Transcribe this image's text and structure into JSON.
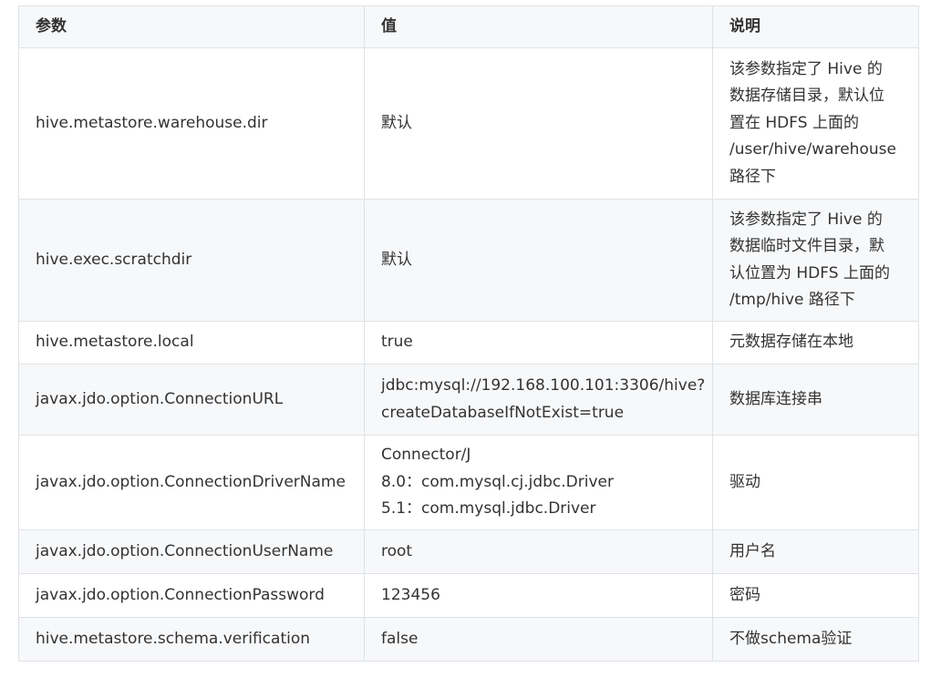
{
  "table": {
    "headers": [
      "参数",
      "值",
      "说明"
    ],
    "rows": [
      {
        "param": "hive.metastore.warehouse.dir",
        "value": [
          "默认"
        ],
        "desc": [
          "该参数指定了 Hive 的",
          "数据存储目录，默认位",
          "置在 HDFS 上面的",
          "/user/hive/warehouse",
          "路径下"
        ]
      },
      {
        "param": "hive.exec.scratchdir",
        "value": [
          "默认"
        ],
        "desc": [
          "该参数指定了 Hive 的",
          "数据临时文件目录，默",
          "认位置为 HDFS 上面的",
          "/tmp/hive 路径下"
        ]
      },
      {
        "param": "hive.metastore.local",
        "value": [
          "true"
        ],
        "desc": [
          "元数据存储在本地"
        ]
      },
      {
        "param": "javax.jdo.option.ConnectionURL",
        "value": [
          "jdbc:mysql://192.168.100.101:3306/hive?",
          "createDatabaseIfNotExist=true"
        ],
        "desc": [
          "数据库连接串"
        ]
      },
      {
        "param": "javax.jdo.option.ConnectionDriverName",
        "value": [
          "Connector/J",
          "8.0：com.mysql.cj.jdbc.Driver",
          "5.1：com.mysql.jdbc.Driver"
        ],
        "desc": [
          "驱动"
        ]
      },
      {
        "param": "javax.jdo.option.ConnectionUserName",
        "value": [
          "root"
        ],
        "desc": [
          "用户名"
        ]
      },
      {
        "param": "javax.jdo.option.ConnectionPassword",
        "value": [
          "123456"
        ],
        "desc": [
          "密码"
        ]
      },
      {
        "param": "hive.metastore.schema.verification",
        "value": [
          "false"
        ],
        "desc": [
          "不做schema验证"
        ]
      }
    ]
  }
}
